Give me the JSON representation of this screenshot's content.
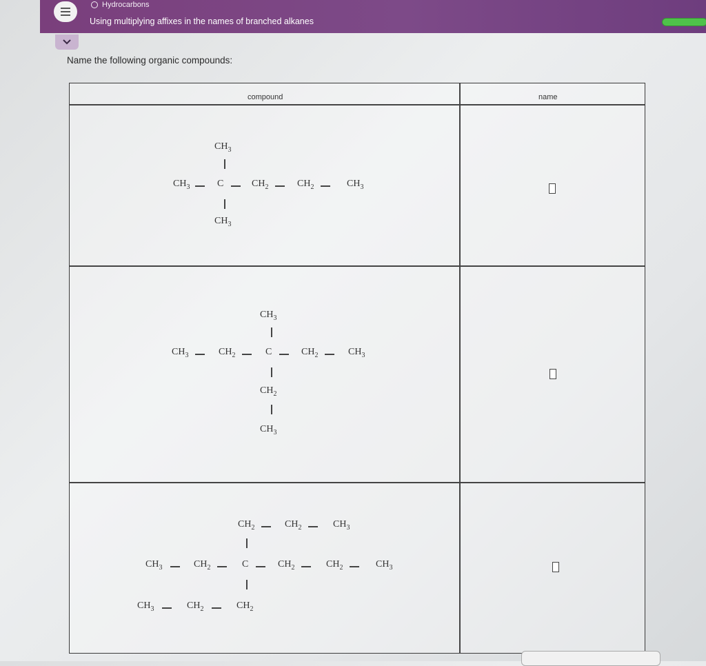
{
  "header": {
    "topic": "Hydrocarbons",
    "title": "Using multiplying affixes in the names of branched alkanes"
  },
  "colors": {
    "header_bg": "#7a3f7c",
    "progress": "#4fc24a"
  },
  "instructions": "Name the following organic compounds:",
  "table": {
    "headers": {
      "compound": "compound",
      "name": "name"
    }
  },
  "labels": {
    "ch3": "CH",
    "ch2": "CH",
    "c": "C",
    "sub3": "3",
    "sub2": "2"
  }
}
